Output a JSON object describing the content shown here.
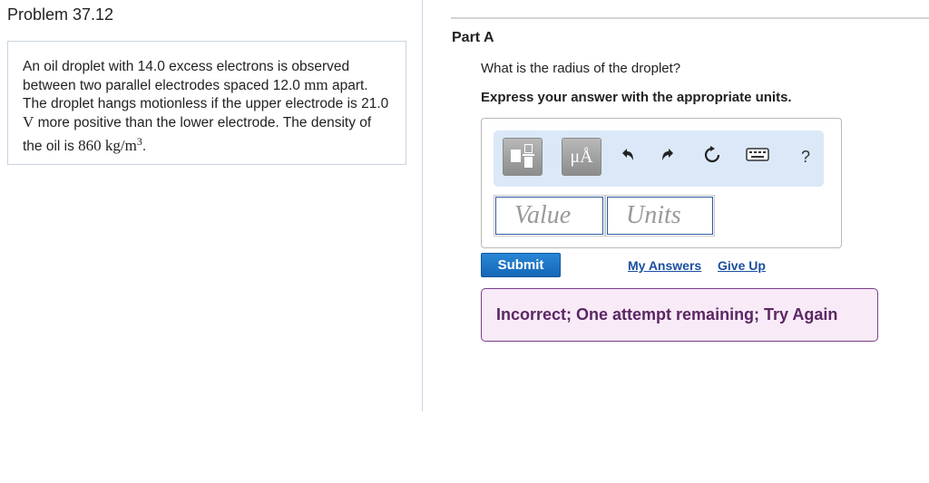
{
  "problem": {
    "title": "Problem 37.12",
    "text_1": "An oil droplet with 14.0 excess electrons is observed between two parallel electrodes spaced 12.0 ",
    "unit_mm": "mm",
    "text_2": " apart. The droplet hangs motionless if the upper electrode is 21.0 ",
    "unit_V": "V",
    "text_3": " more positive than the lower electrode. The density of the oil is ",
    "density_value": "860 kg/m",
    "density_exp": "3",
    "text_4": "."
  },
  "part": {
    "label": "Part A",
    "question": "What is the radius of the droplet?",
    "instruction": "Express your answer with the appropriate units."
  },
  "toolbar": {
    "units_label": "μÅ",
    "icons": [
      "templates-icon",
      "units-icon",
      "undo-icon",
      "redo-icon",
      "reset-icon",
      "keyboard-icon",
      "help-icon"
    ],
    "help_label": "?"
  },
  "answer": {
    "value_placeholder": "Value",
    "units_placeholder": "Units"
  },
  "actions": {
    "submit_label": "Submit",
    "my_answers_label": "My Answers",
    "give_up_label": "Give Up"
  },
  "feedback": {
    "message": "Incorrect; One attempt remaining; Try Again"
  },
  "colors": {
    "accent": "#1a6fc2",
    "feedback_border": "#7a3f8a",
    "feedback_bg": "#f9eaf8",
    "toolbar_bg": "#dbe8f8"
  }
}
